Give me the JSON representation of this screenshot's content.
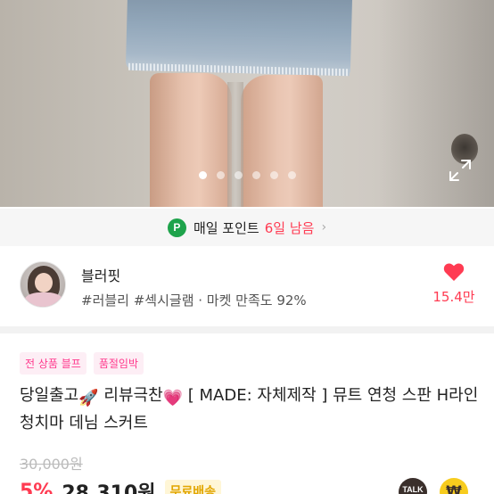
{
  "hero": {
    "image_alt": "product-photo",
    "carousel_total": 6,
    "carousel_active": 1
  },
  "points": {
    "badge": "P",
    "label": "매일 포인트",
    "days_left": "6일 남음",
    "chevron": "›"
  },
  "shop": {
    "name": "블러핏",
    "tags": "#러블리 #섹시글램 · 마켓 만족도 92%",
    "fav_count": "15.4만"
  },
  "product": {
    "badges": [
      "전 상품 블프",
      "품절임박"
    ],
    "title_part1": "당일출고",
    "title_emoji1": "🚀",
    "title_part2": " 리뷰극찬",
    "title_emoji2": "💗",
    "title_part3": " [ MADE: 자체제작 ] 뮤트 연청 스판 H라인 청치마 데님 스커트",
    "original_price": "30,000원",
    "discount": "5%",
    "price": "28,310원",
    "shipping": "무료배송"
  },
  "actions": {
    "talk_label": "TALK",
    "won_symbol": "₩"
  },
  "colors": {
    "accent": "#ff3b52",
    "points_green": "#1ea34b",
    "badge_pink": "#ff3b8e",
    "shipping_yellow": "#e2a600",
    "kakao_yellow": "#f7cc1e"
  }
}
